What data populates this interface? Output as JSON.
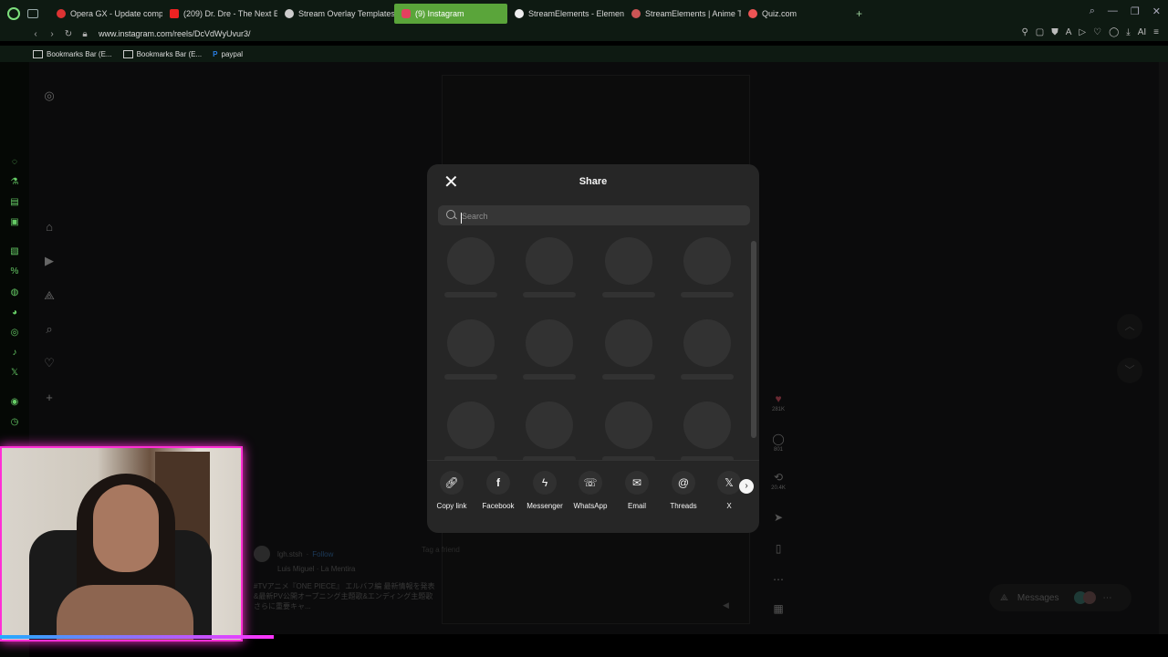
{
  "browser": {
    "tabs": [
      {
        "label": "Opera GX - Update comple",
        "color": "#d33"
      },
      {
        "label": "(209) Dr. Dre - The Next E",
        "color": "#e22"
      },
      {
        "label": "Stream Overlay Templates",
        "color": "#ccc"
      },
      {
        "label": "(9) Instagram",
        "color": "#e4405f"
      },
      {
        "label": "StreamElements - Element",
        "color": "#eee"
      },
      {
        "label": "StreamElements | Anime T",
        "color": "#c55"
      },
      {
        "label": "Quiz.com",
        "color": "#e55"
      }
    ],
    "url": "www.instagram.com/reels/DcVdWyUvur3/",
    "bookmarks": [
      "Bookmarks Bar (E...",
      "Bookmarks Bar (E...",
      "paypal"
    ],
    "addr_right_ai": "AI"
  },
  "reel": {
    "likes": "281K",
    "comments": "801",
    "shares": "20.4K",
    "user": "lgh.stsh",
    "follow": "Follow",
    "audio": "Luis Miguel · La Mentira",
    "tag": "Tag a friend",
    "caption": "#TVアニメ『ONE PIECE』 エルバフ編 最新情報を発表&最新PV公開オープニング主題歌&エンディング主題歌 さらに重要キャ..."
  },
  "messages": {
    "label": "Messages",
    "badge": "9+"
  },
  "share": {
    "title": "Share",
    "search_placeholder": "Search",
    "options": [
      {
        "label": "Copy link",
        "icon": "link-icon"
      },
      {
        "label": "Facebook",
        "icon": "facebook-icon"
      },
      {
        "label": "Messenger",
        "icon": "messenger-icon"
      },
      {
        "label": "WhatsApp",
        "icon": "whatsapp-icon"
      },
      {
        "label": "Email",
        "icon": "email-icon"
      },
      {
        "label": "Threads",
        "icon": "threads-icon"
      },
      {
        "label": "X",
        "icon": "x-icon"
      }
    ]
  }
}
